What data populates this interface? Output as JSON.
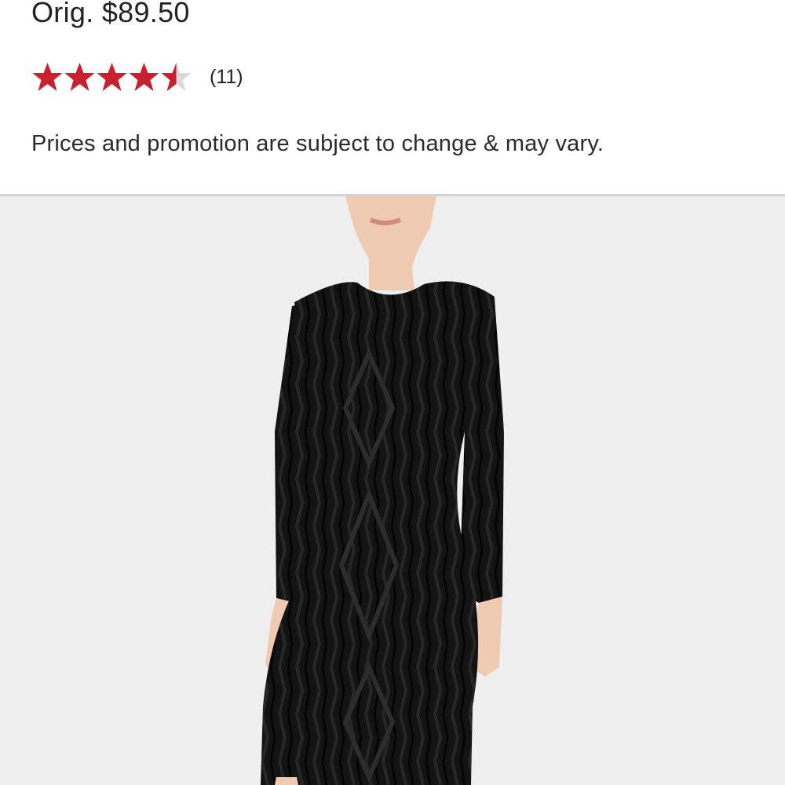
{
  "product": {
    "orig_price": "Orig. $89.50",
    "rating": {
      "value": 4.5,
      "max": 5,
      "review_count": "(11)",
      "star_color": "#c8202f",
      "empty_star_color": "#d9d9d9"
    },
    "disclaimer": "Prices and promotion are subject to change & may vary.",
    "image": {
      "icon": "product-photo-black-dress",
      "background_color": "#efefef",
      "dress_color": "#111111",
      "skin_color": "#f2cfb8"
    }
  }
}
